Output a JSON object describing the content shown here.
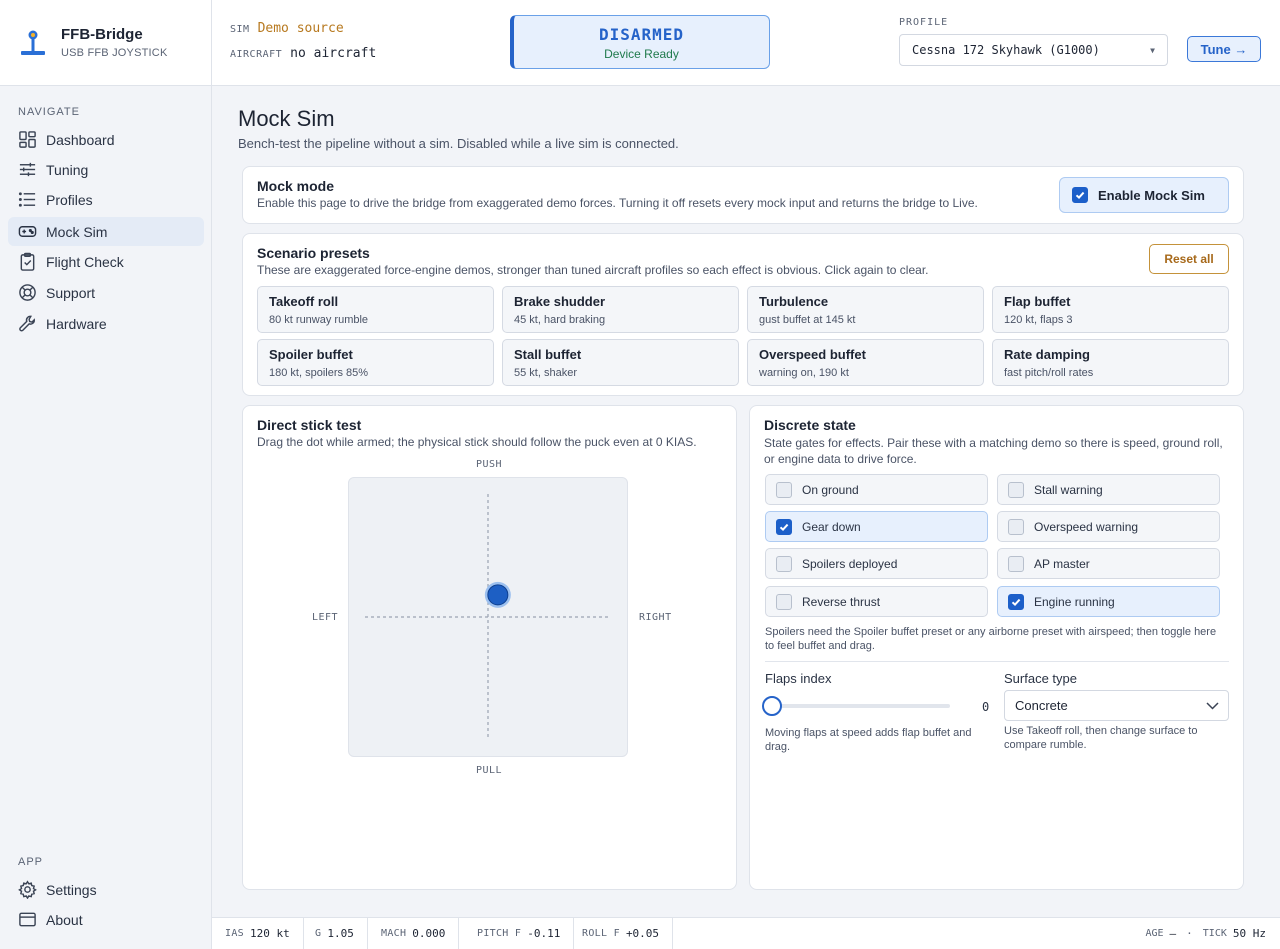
{
  "brand": {
    "title": "FFB-Bridge",
    "subtitle": "USB FFB JOYSTICK"
  },
  "nav": {
    "section_label": "NAVIGATE",
    "items": [
      {
        "label": "Dashboard",
        "icon": "dashboard-icon"
      },
      {
        "label": "Tuning",
        "icon": "sliders-icon"
      },
      {
        "label": "Profiles",
        "icon": "list-icon"
      },
      {
        "label": "Mock Sim",
        "icon": "gamepad-icon",
        "active": true
      },
      {
        "label": "Flight Check",
        "icon": "clipboard-icon"
      },
      {
        "label": "Support",
        "icon": "lifebuoy-icon"
      },
      {
        "label": "Hardware",
        "icon": "wrench-icon"
      }
    ],
    "app_label": "APP",
    "app_items": [
      {
        "label": "Settings",
        "icon": "gear-icon"
      },
      {
        "label": "About",
        "icon": "window-icon"
      }
    ]
  },
  "header": {
    "sim_key": "SIM",
    "sim_value": "Demo source",
    "aircraft_key": "AIRCRAFT",
    "aircraft_value": "no aircraft",
    "arm_state": "DISARMED",
    "arm_sub": "Device Ready",
    "profile_label": "PROFILE",
    "profile_value": "Cessna 172 Skyhawk (G1000)",
    "tune_label": "Tune →"
  },
  "page": {
    "title": "Mock Sim",
    "subtitle": "Bench-test the pipeline without a sim. Disabled while a live sim is connected."
  },
  "mock_mode": {
    "title": "Mock mode",
    "desc": "Enable this page to drive the bridge from exaggerated demo forces. Turning it off resets every mock input and returns the bridge to Live.",
    "enable_label": "Enable Mock Sim",
    "enabled": true
  },
  "presets": {
    "title": "Scenario presets",
    "desc": "These are exaggerated force-engine demos, stronger than tuned aircraft profiles so each effect is obvious. Click again to clear.",
    "reset_label": "Reset all",
    "items": [
      {
        "name": "Takeoff roll",
        "desc": "80 kt runway rumble"
      },
      {
        "name": "Brake shudder",
        "desc": "45 kt, hard braking"
      },
      {
        "name": "Turbulence",
        "desc": "gust buffet at 145 kt"
      },
      {
        "name": "Flap buffet",
        "desc": "120 kt, flaps 3"
      },
      {
        "name": "Spoiler buffet",
        "desc": "180 kt, spoilers 85%"
      },
      {
        "name": "Stall buffet",
        "desc": "55 kt, shaker"
      },
      {
        "name": "Overspeed buffet",
        "desc": "warning on, 190 kt"
      },
      {
        "name": "Rate damping",
        "desc": "fast pitch/roll rates"
      }
    ]
  },
  "stick": {
    "title": "Direct stick test",
    "desc": "Drag the dot while armed; the physical stick should follow the puck even at 0 KIAS.",
    "push": "PUSH",
    "pull": "PULL",
    "left": "LEFT",
    "right": "RIGHT",
    "roll": 0.08,
    "pitch": 0.18
  },
  "discrete": {
    "title": "Discrete state",
    "desc": "State gates for effects. Pair these with a matching demo so there is speed, ground roll, or engine data to drive force.",
    "toggles": [
      {
        "label": "On ground",
        "on": false
      },
      {
        "label": "Stall warning",
        "on": false
      },
      {
        "label": "Gear down",
        "on": true
      },
      {
        "label": "Overspeed warning",
        "on": false
      },
      {
        "label": "Spoilers deployed",
        "on": false
      },
      {
        "label": "AP master",
        "on": false
      },
      {
        "label": "Reverse thrust",
        "on": false
      },
      {
        "label": "Engine running",
        "on": true
      }
    ],
    "note": "Spoilers need the Spoiler buffet preset or any airborne preset with airspeed; then toggle here to feel buffet and drag.",
    "flaps_label": "Flaps index",
    "flaps_value": "0",
    "flaps_fraction": 0,
    "flaps_hint": "Moving flaps at speed adds flap buffet and drag.",
    "surface_label": "Surface type",
    "surface_value": "Concrete",
    "surface_hint": "Use Takeoff roll, then change surface to compare rumble."
  },
  "status": {
    "ias_key": "IAS",
    "ias_val": "120 kt",
    "g_key": "G",
    "g_val": "1.05",
    "mach_key": "MACH",
    "mach_val": "0.000",
    "pitch_key": "PITCH F",
    "pitch_val": "-0.11",
    "roll_key": "ROLL F",
    "roll_val": "+0.05",
    "age_key": "AGE",
    "age_val": "—",
    "sep": "·",
    "tick_key": "TICK",
    "tick_val": "50 Hz"
  },
  "colors": {
    "accent": "#2563c9",
    "amber": "#b7791f",
    "ready": "#1f7a4c"
  }
}
